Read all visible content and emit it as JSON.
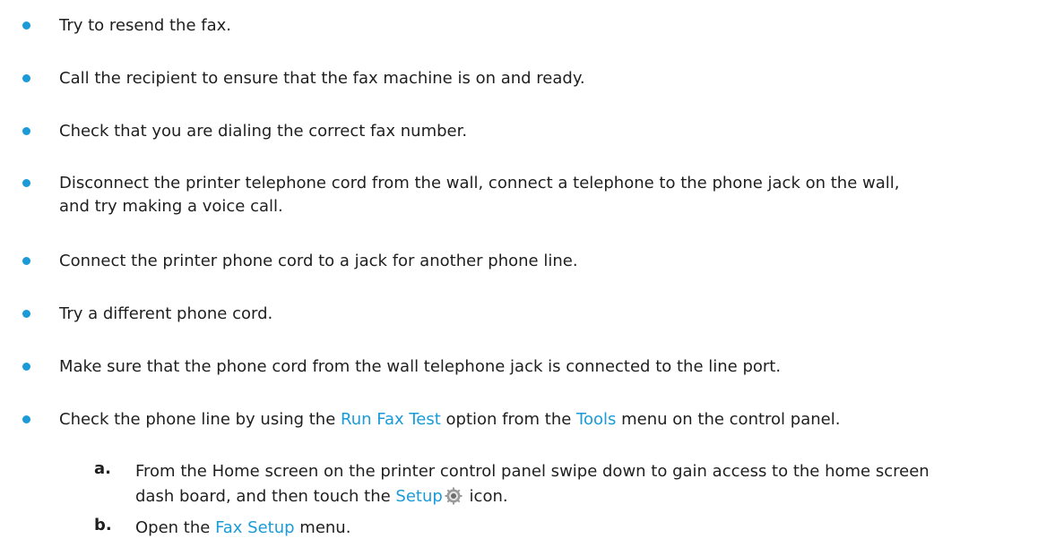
{
  "colors": {
    "accent": "#1a9bd8",
    "text": "#1f1f1f"
  },
  "bullets": [
    {
      "text": "Try to resend the fax."
    },
    {
      "text": "Call the recipient to ensure that the fax machine is on and ready."
    },
    {
      "text": "Check that you are dialing the correct fax number."
    },
    {
      "line1": "Disconnect the printer telephone cord from the wall, connect a telephone to the phone jack on the wall,",
      "line2": "and try making a voice call."
    },
    {
      "text": "Connect the printer phone cord to a jack for another phone line."
    },
    {
      "text": "Try a different phone cord."
    },
    {
      "text": "Make sure that the phone cord from the wall telephone jack is connected to the line port."
    },
    {
      "pre": "Check the phone line by using the ",
      "link1": "Run Fax Test",
      "mid": " option from the ",
      "link2": "Tools",
      "post": " menu on the control panel."
    }
  ],
  "steps": [
    {
      "letter": "a.",
      "line1": "From the Home screen on the printer control panel swipe down to gain access to the home screen",
      "line2_pre": "dash board, and then touch the ",
      "link": "Setup",
      "icon": "gear-icon",
      "line2_post": " icon."
    },
    {
      "letter": "b.",
      "pre": "Open the ",
      "link": "Fax Setup",
      "post": " menu."
    }
  ]
}
